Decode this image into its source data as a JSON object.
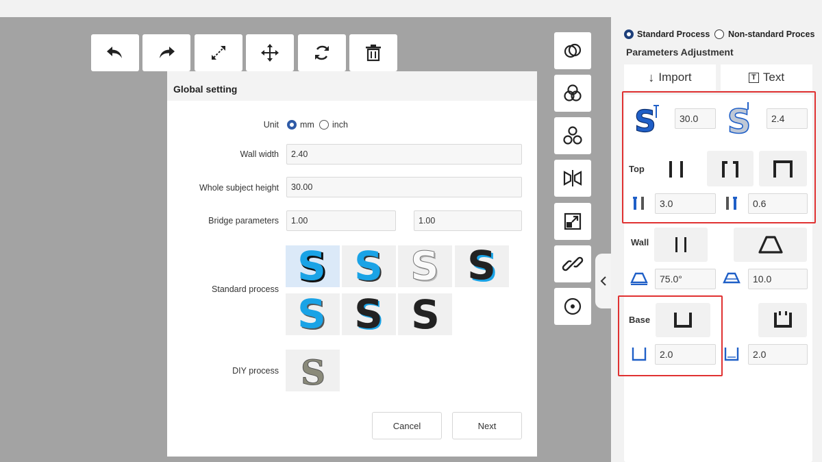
{
  "colors": {
    "canvas": "#a3a3a3",
    "accent": "#2f5ba7",
    "highlight_box": "#e03131",
    "s_blue": "#1aa3e6",
    "s_dark": "#222222"
  },
  "toolbar": {
    "icons": [
      "undo-icon",
      "redo-icon",
      "scale-icon",
      "move-icon",
      "rotate-icon",
      "delete-icon"
    ]
  },
  "side_toolbar": {
    "icons": [
      "intersect-icon",
      "union-icon",
      "subtract-icon",
      "mirror-icon",
      "resize-icon",
      "link-icon",
      "center-icon"
    ]
  },
  "dialog": {
    "title": "Global setting",
    "unit_label": "Unit",
    "unit_options": [
      "mm",
      "inch"
    ],
    "unit_selected": "mm",
    "wall_width_label": "Wall width",
    "wall_width_value": "2.40",
    "height_label": "Whole subject  height",
    "height_value": "30.00",
    "bridge_label": "Bridge  parameters",
    "bridge_value_1": "1.00",
    "bridge_value_2": "1.00",
    "standard_label": "Standard process",
    "diy_label": "DIY process",
    "cancel_label": "Cancel",
    "next_label": "Next"
  },
  "panel": {
    "process_standard": "Standard Process",
    "process_nonstandard": "Non-standard Proces",
    "title": "Parameters Adjustment",
    "import_label": "Import",
    "text_label": "Text",
    "height_value": "30.0",
    "wall_value": "2.4",
    "top_label": "Top",
    "top_value_1": "3.0",
    "top_value_2": "0.6",
    "wall_label": "Wall",
    "wall_angle_value": "75.0°",
    "wall_offset_value": "10.0",
    "base_label": "Base",
    "base_value_1": "2.0",
    "base_value_2": "2.0"
  }
}
